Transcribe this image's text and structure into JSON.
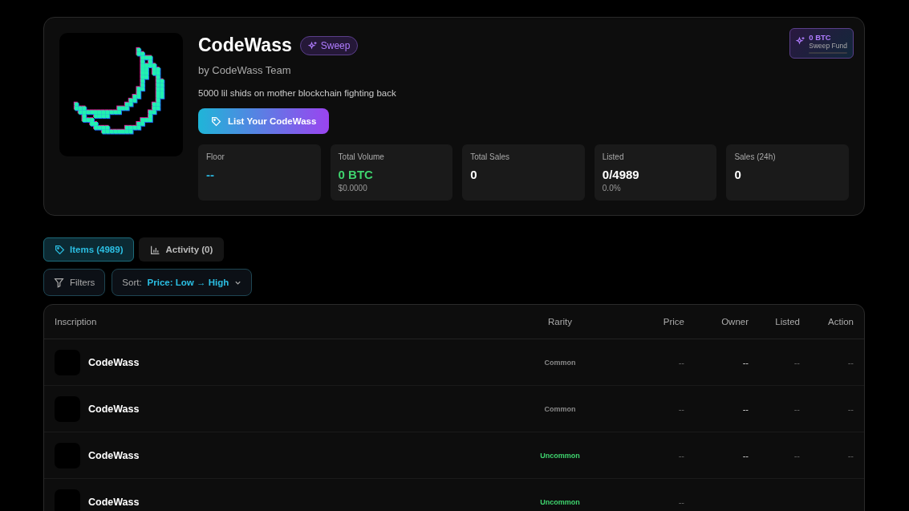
{
  "collection": {
    "name": "CodeWass",
    "sweep_badge": "Sweep",
    "creator": "by CodeWass Team",
    "description": "5000 lil shids on mother blockchain fighting back",
    "list_button": "List Your CodeWass"
  },
  "sweep_fund": {
    "amount": "0 BTC",
    "label": "Sweep Fund",
    "level": 0
  },
  "stats": [
    {
      "label": "Floor",
      "value": "--",
      "kind": "accent"
    },
    {
      "label": "Total Volume",
      "value": "0 BTC",
      "sub": "$0.0000",
      "kind": "positive"
    },
    {
      "label": "Total Sales",
      "value": "0",
      "kind": "plain"
    },
    {
      "label": "Listed",
      "value": "0/4989",
      "sub": "0.0%",
      "kind": "plain"
    },
    {
      "label": "Sales (24h)",
      "value": "0",
      "kind": "plain"
    }
  ],
  "tabs": [
    {
      "label": "Items (4989)",
      "kind": "tag",
      "selected": true
    },
    {
      "label": "Activity (0)",
      "kind": "chart",
      "selected": false
    }
  ],
  "filters_button": "Filters",
  "sort": {
    "label": "Sort:",
    "value": "Price: Low → High"
  },
  "table": {
    "columns": [
      "Inscription",
      "Rarity",
      "Price",
      "Owner",
      "Listed",
      "Action"
    ],
    "rows": [
      {
        "name": "CodeWass",
        "rarity": "Common",
        "kind": "common",
        "price": "--",
        "owner": "--",
        "listed": "--",
        "action": "--"
      },
      {
        "name": "CodeWass",
        "rarity": "Common",
        "kind": "common",
        "price": "--",
        "owner": "--",
        "listed": "--",
        "action": "--"
      },
      {
        "name": "CodeWass",
        "rarity": "Uncommon",
        "kind": "uncommon",
        "price": "--",
        "owner": "--",
        "listed": "--",
        "action": "--"
      },
      {
        "name": "CodeWass",
        "rarity": "Uncommon",
        "kind": "uncommon",
        "price": "--"
      }
    ]
  }
}
